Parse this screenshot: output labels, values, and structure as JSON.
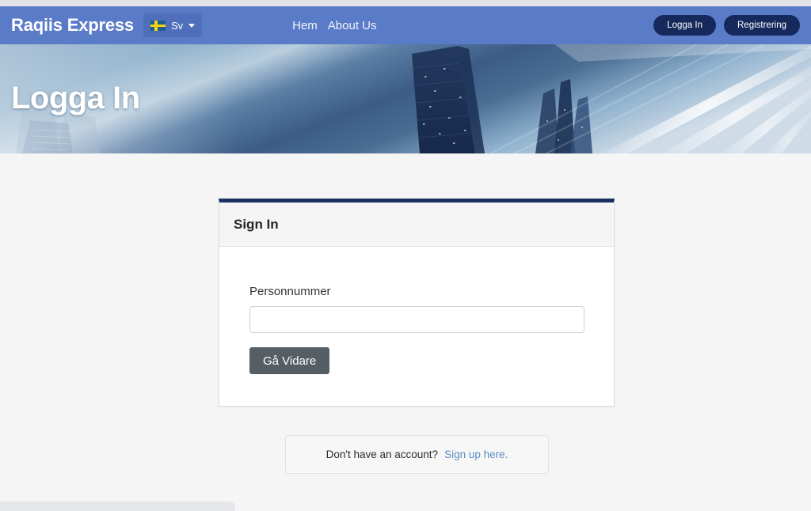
{
  "navbar": {
    "brand": "Raqiis Express",
    "language": {
      "flag_icon": "swedish-flag-icon",
      "label": "Sv",
      "caret_icon": "chevron-down-icon"
    },
    "links": [
      {
        "label": "Hem"
      },
      {
        "label": "About Us"
      }
    ],
    "actions": [
      {
        "label": "Logga In"
      },
      {
        "label": "Registrering"
      }
    ],
    "bg_color": "#5a7bc8",
    "button_color": "#16295c"
  },
  "hero": {
    "title": "Logga In",
    "image_alt": "blue city skyline at night with light streaks"
  },
  "card": {
    "title": "Sign In",
    "accent_color": "#1a3060",
    "field": {
      "label": "Personnummer",
      "value": "",
      "placeholder": ""
    },
    "submit_label": "Gå Vidare",
    "submit_color": "#555e64"
  },
  "signup": {
    "text": "Don't have an account?",
    "link_label": "Sign up here.",
    "link_color": "#5b8cc4"
  }
}
